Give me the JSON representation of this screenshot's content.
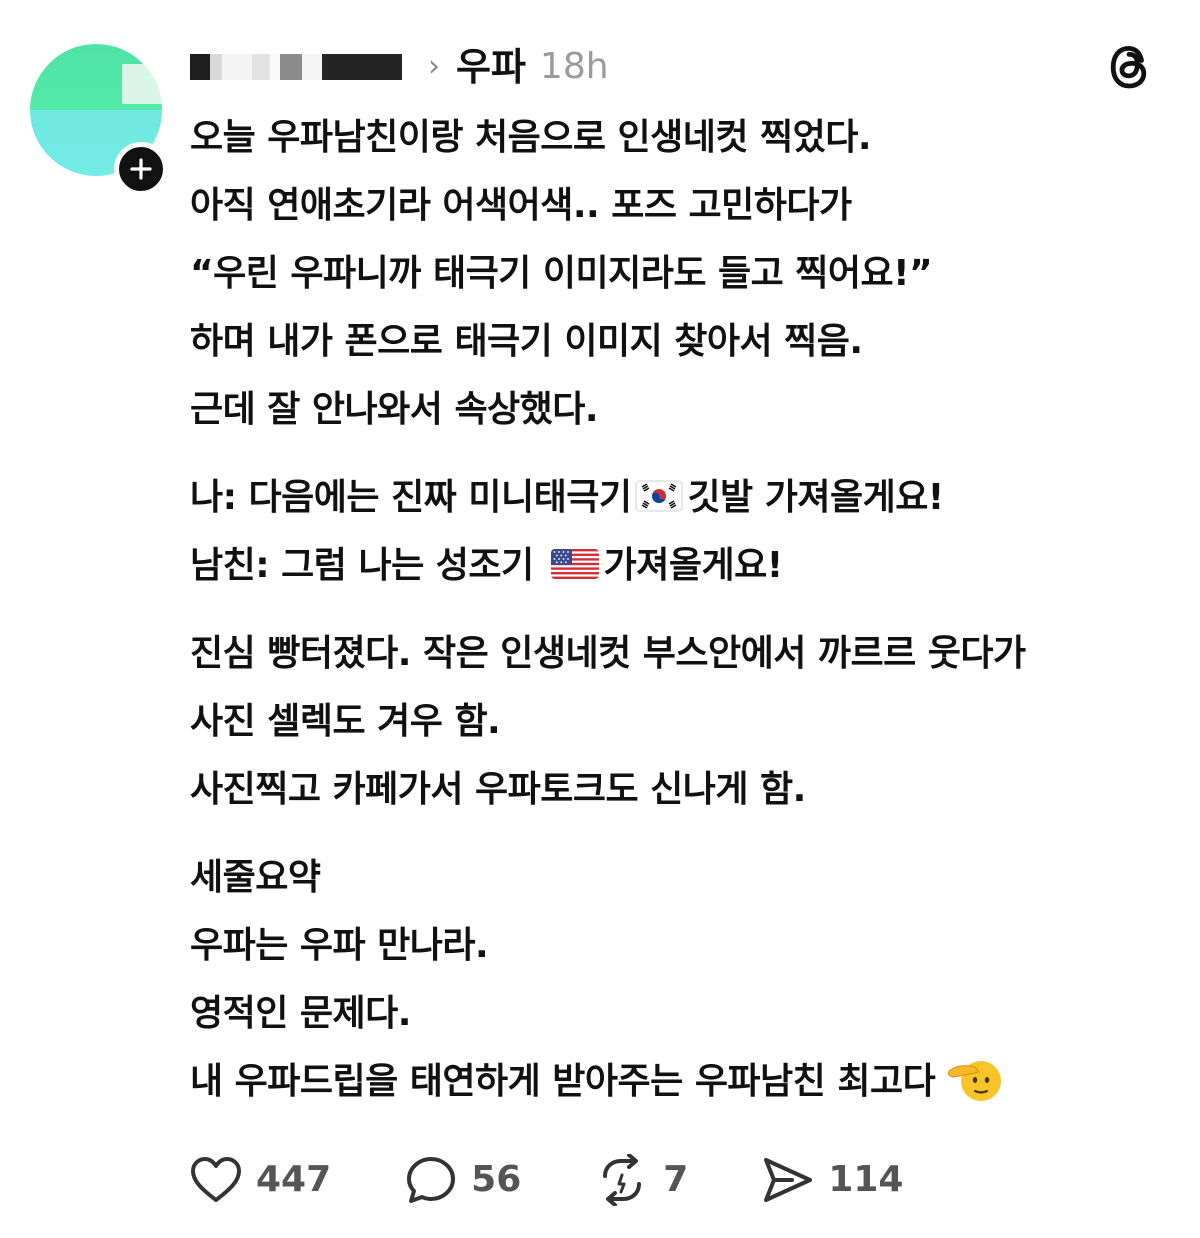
{
  "header": {
    "community": "우파",
    "timestamp": "18h",
    "chevron": "›"
  },
  "body": {
    "lines": [
      "오늘 우파남친이랑 처음으로 인생네컷 찍었다.",
      "아직 연애초기라 어색어색.. 포즈 고민하다가",
      "“우린 우파니까 태극기 이미지라도 들고 찍어요!”",
      "하며 내가 폰으로 태극기 이미지 찾아서 찍음.",
      "근데 잘 안나와서 속상했다.",
      "나: 다음에는 진짜 미니태극기",
      "깃발 가져올게요!",
      "남친: 그럼 나는 성조기",
      "가져올게요!",
      "진심 빵터졌다. 작은 인생네컷 부스안에서 까르르 웃다가",
      "사진 셀렉도 겨우 함.",
      "사진찍고 카페가서 우파토크도 신나게 함.",
      "세줄요약",
      "우파는 우파 만나라.",
      "영적인 문제다.",
      "내 우파드립을 태연하게 받아주는 우파남친 최고다"
    ]
  },
  "actions": {
    "likes": "447",
    "comments": "56",
    "reposts": "7",
    "shares": "114"
  },
  "icons": {
    "avatar": "avatar",
    "follow": "plus-icon",
    "logo": "threads-logo-icon",
    "like": "heart-icon",
    "comment": "comment-bubble-icon",
    "repost": "repost-icon",
    "share": "send-icon",
    "flag_kr": "south-korea-flag-emoji",
    "flag_us": "us-flag-emoji",
    "salute": "saluting-face-emoji"
  },
  "colors": {
    "text": "#111111",
    "muted": "#9b9b9b",
    "count": "#555555",
    "avatar_top": "#52eaa8",
    "avatar_bottom": "#74ece6"
  }
}
